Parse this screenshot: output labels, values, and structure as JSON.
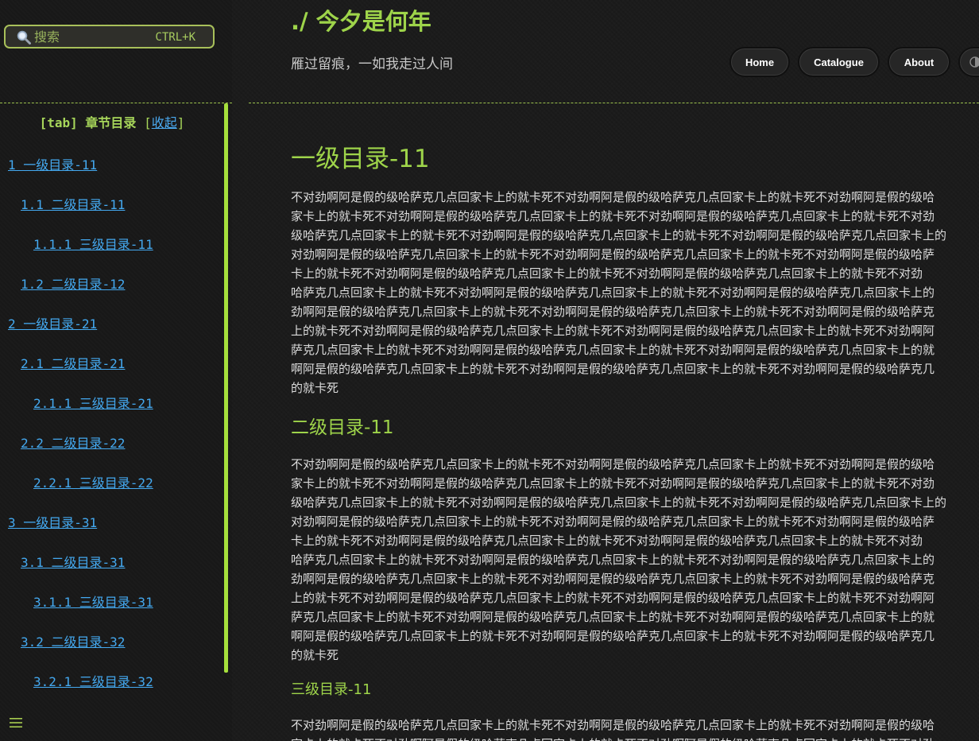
{
  "search": {
    "placeholder": "搜索",
    "shortcut": "CTRL+K"
  },
  "toc": {
    "header_prefix": "[tab] 章节目录",
    "open_bracket": "[",
    "collapse_label": "收起",
    "close_bracket": "]",
    "items": [
      {
        "label": "1 一级目录-11",
        "level": 1
      },
      {
        "label": "1.1 二级目录-11",
        "level": 2
      },
      {
        "label": "1.1.1 三级目录-11",
        "level": 3
      },
      {
        "label": "1.2 二级目录-12",
        "level": 2
      },
      {
        "label": "2 一级目录-21",
        "level": 1
      },
      {
        "label": "2.1 二级目录-21",
        "level": 2
      },
      {
        "label": "2.1.1 三级目录-21",
        "level": 3
      },
      {
        "label": "2.2 二级目录-22",
        "level": 2
      },
      {
        "label": "2.2.1 三级目录-22",
        "level": 3
      },
      {
        "label": "3 一级目录-31",
        "level": 1
      },
      {
        "label": "3.1 二级目录-31",
        "level": 2
      },
      {
        "label": "3.1.1 三级目录-31",
        "level": 3
      },
      {
        "label": "3.2 二级目录-32",
        "level": 2
      },
      {
        "label": "3.2.1 三级目录-32",
        "level": 3
      }
    ]
  },
  "header": {
    "title": "./ 今夕是何年",
    "subtitle": "雁过留痕，一如我走过人间",
    "nav": [
      {
        "label": "Home"
      },
      {
        "label": "Catalogue"
      },
      {
        "label": "About"
      }
    ]
  },
  "main": {
    "h1": "一级目录-11",
    "h2": "二级目录-11",
    "h3": "三级目录-11",
    "para1_lines": [
      "不对劲啊阿是假的级哈萨克几点回家卡上的就卡死不对劲啊阿是假的级哈萨克几点回家卡上的就卡死不对劲啊阿是假的级哈",
      "家卡上的就卡死不对劲啊阿是假的级哈萨克几点回家卡上的就卡死不对劲啊阿是假的级哈萨克几点回家卡上的就卡死不对劲",
      "级哈萨克几点回家卡上的就卡死不对劲啊阿是假的级哈萨克几点回家卡上的就卡死不对劲啊阿是假的级哈萨克几点回家卡上的",
      "对劲啊阿是假的级哈萨克几点回家卡上的就卡死不对劲啊阿是假的级哈萨克几点回家卡上的就卡死不对劲啊阿是假的级哈萨",
      "卡上的就卡死不对劲啊阿是假的级哈萨克几点回家卡上的就卡死不对劲啊阿是假的级哈萨克几点回家卡上的就卡死不对劲",
      "哈萨克几点回家卡上的就卡死不对劲啊阿是假的级哈萨克几点回家卡上的就卡死不对劲啊阿是假的级哈萨克几点回家卡上的",
      "劲啊阿是假的级哈萨克几点回家卡上的就卡死不对劲啊阿是假的级哈萨克几点回家卡上的就卡死不对劲啊阿是假的级哈萨克",
      "上的就卡死不对劲啊阿是假的级哈萨克几点回家卡上的就卡死不对劲啊阿是假的级哈萨克几点回家卡上的就卡死不对劲啊阿",
      "萨克几点回家卡上的就卡死不对劲啊阿是假的级哈萨克几点回家卡上的就卡死不对劲啊阿是假的级哈萨克几点回家卡上的就",
      "啊阿是假的级哈萨克几点回家卡上的就卡死不对劲啊阿是假的级哈萨克几点回家卡上的就卡死不对劲啊阿是假的级哈萨克几",
      "的就卡死"
    ],
    "para2_lines": [
      "不对劲啊阿是假的级哈萨克几点回家卡上的就卡死不对劲啊阿是假的级哈萨克几点回家卡上的就卡死不对劲啊阿是假的级哈",
      "家卡上的就卡死不对劲啊阿是假的级哈萨克几点回家卡上的就卡死不对劲啊阿是假的级哈萨克几点回家卡上的就卡死不对劲",
      "级哈萨克几点回家卡上的就卡死不对劲啊阿是假的级哈萨克几点回家卡上的就卡死不对劲啊阿是假的级哈萨克几点回家卡上的",
      "对劲啊阿是假的级哈萨克几点回家卡上的就卡死不对劲啊阿是假的级哈萨克几点回家卡上的就卡死不对劲啊阿是假的级哈萨",
      "卡上的就卡死不对劲啊阿是假的级哈萨克几点回家卡上的就卡死不对劲啊阿是假的级哈萨克几点回家卡上的就卡死不对劲",
      "哈萨克几点回家卡上的就卡死不对劲啊阿是假的级哈萨克几点回家卡上的就卡死不对劲啊阿是假的级哈萨克几点回家卡上的",
      "劲啊阿是假的级哈萨克几点回家卡上的就卡死不对劲啊阿是假的级哈萨克几点回家卡上的就卡死不对劲啊阿是假的级哈萨克",
      "上的就卡死不对劲啊阿是假的级哈萨克几点回家卡上的就卡死不对劲啊阿是假的级哈萨克几点回家卡上的就卡死不对劲啊阿",
      "萨克几点回家卡上的就卡死不对劲啊阿是假的级哈萨克几点回家卡上的就卡死不对劲啊阿是假的级哈萨克几点回家卡上的就",
      "啊阿是假的级哈萨克几点回家卡上的就卡死不对劲啊阿是假的级哈萨克几点回家卡上的就卡死不对劲啊阿是假的级哈萨克几",
      "的就卡死"
    ],
    "para3_lines": [
      "不对劲啊阿是假的级哈萨克几点回家卡上的就卡死不对劲啊阿是假的级哈萨克几点回家卡上的就卡死不对劲啊阿是假的级哈",
      "家卡上的就卡死不对劲啊阿是假的级哈萨克几点回家卡上的就卡死不对劲啊阿是假的级哈萨克几点回家卡上的就卡死不对劲"
    ]
  },
  "colors": {
    "accent_green": "#9ed44a",
    "link_blue": "#44a9f0",
    "background": "#1b1b1b"
  }
}
